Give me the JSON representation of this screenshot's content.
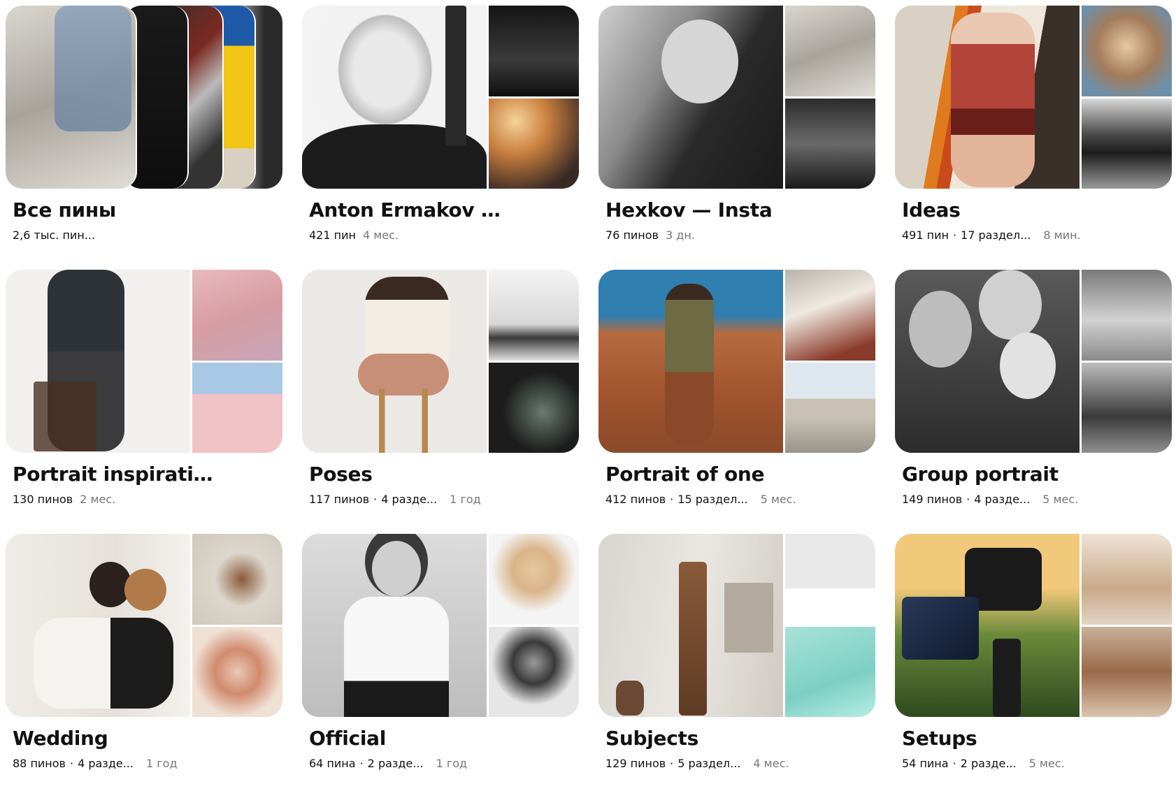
{
  "boards": [
    {
      "title": "Все пины",
      "count": "2,6 тыс. пин...",
      "sections": "",
      "time": ""
    },
    {
      "title": "Anton Ermakov —...",
      "count": "421 пин",
      "sections": "",
      "time": "4 мес."
    },
    {
      "title": "Hexkov — Insta",
      "count": "76 пинов",
      "sections": "",
      "time": "3 дн."
    },
    {
      "title": "Ideas",
      "count": "491 пин",
      "sections": "17 раздел...",
      "time": "8 мин."
    },
    {
      "title": "Portrait inspirations",
      "count": "130 пинов",
      "sections": "",
      "time": "2 мес."
    },
    {
      "title": "Poses",
      "count": "117 пинов",
      "sections": "4 разде...",
      "time": "1 год"
    },
    {
      "title": "Portrait of one",
      "count": "412 пинов",
      "sections": "15 раздел...",
      "time": "5 мес."
    },
    {
      "title": "Group portrait",
      "count": "149 пинов",
      "sections": "4 разде...",
      "time": "5 мес."
    },
    {
      "title": "Wedding",
      "count": "88 пинов",
      "sections": "4 разде...",
      "time": "1 год"
    },
    {
      "title": "Official",
      "count": "64 пина",
      "sections": "2 разде...",
      "time": "1 год"
    },
    {
      "title": "Subjects",
      "count": "129 пинов",
      "sections": "5 раздел...",
      "time": "4 мес."
    },
    {
      "title": "Setups",
      "count": "54 пина",
      "sections": "2 разде...",
      "time": "5 мес."
    }
  ],
  "separator": "·"
}
